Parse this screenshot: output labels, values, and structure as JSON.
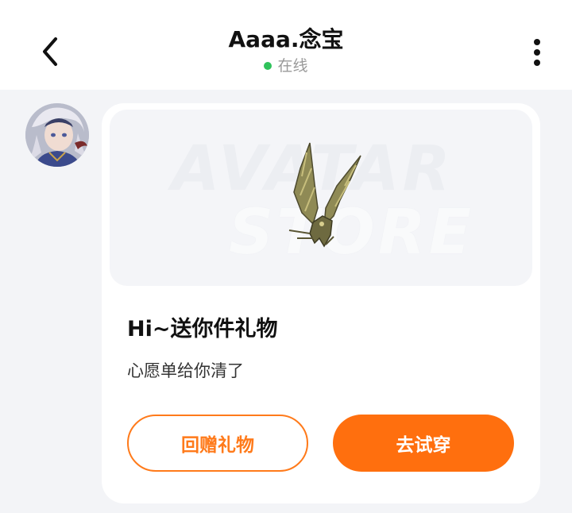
{
  "header": {
    "title": "Aaaa.念宝",
    "status": "在线",
    "back_icon": "chevron-left-icon",
    "more_icon": "more-vertical-icon"
  },
  "message": {
    "title": "Hi~送你件礼物",
    "subtitle": "心愿单给你清了",
    "banner_watermark_line1": "AVATAR",
    "banner_watermark_line2": "STORE",
    "gift_icon": "dragon-wings-icon"
  },
  "buttons": {
    "return_gift": "回赠礼物",
    "try_on": "去试穿"
  },
  "colors": {
    "accent": "#ff6f0e",
    "online": "#2fc25b",
    "background": "#f3f4f7"
  }
}
